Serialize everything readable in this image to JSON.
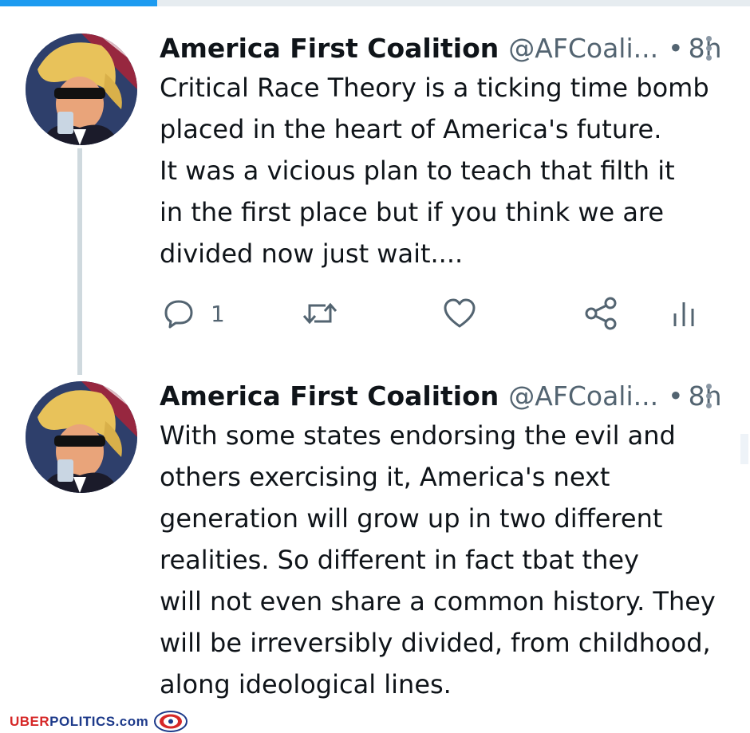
{
  "progress": 0.21,
  "tweets": [
    {
      "name": "America First Coalition",
      "handle": "@AFCoali...",
      "separator": "•",
      "time": "8h",
      "text": "Critical Race Theory is a ticking time bomb\nplaced in the heart of America's future.\nIt was a vicious plan to teach that filth it\nin the first place but if you think we are\ndivided now just wait....",
      "reply_count": "1"
    },
    {
      "name": "America First Coalition",
      "handle": "@AFCoali...",
      "separator": "•",
      "time": "8h",
      "text": "With some states endorsing the evil and\nothers exercising it, America's next\ngeneration will grow up in two different\nrealities. So different in fact tbat they\nwill not even share a common history. They\nwill be irreversibly divided, from childhood,\nalong ideological lines."
    }
  ],
  "footer": {
    "brand_uber": "UBER",
    "brand_politics": "POLITICS",
    "brand_com": ".com"
  },
  "icons": {
    "reply": "reply-icon",
    "retweet": "retweet-icon",
    "like": "heart-icon",
    "share": "share-icon",
    "analytics": "analytics-icon",
    "more": "more-vertical-icon"
  },
  "colors": {
    "accent": "#1d9bf0",
    "text": "#0f1419",
    "secondary": "#536471",
    "brand_red": "#d62828",
    "brand_blue": "#1d3a8a"
  }
}
